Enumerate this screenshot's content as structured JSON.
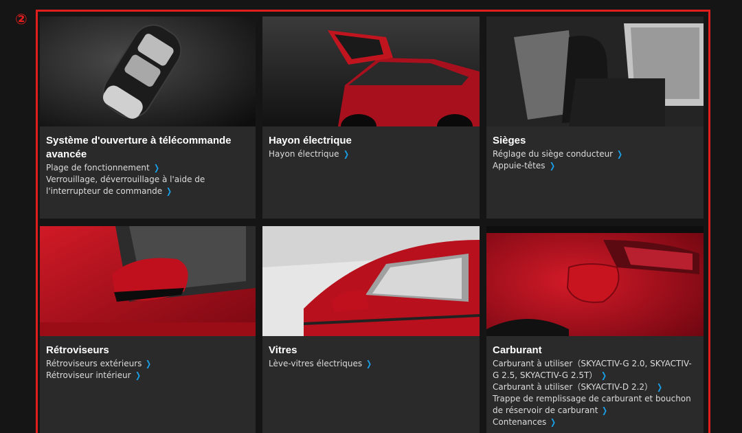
{
  "marker": {
    "text": "②",
    "color": "#e01e1e"
  },
  "accent": {
    "frame": "#e01e1e",
    "chevron": "#1aa0e8"
  },
  "cards": [
    {
      "title": "Système d'ouverture à télécommande avancée",
      "image": "smart-key-fob",
      "links": [
        {
          "label": "Plage de fonctionnement",
          "icon": "chevron-right-icon"
        },
        {
          "label": "Verrouillage, déverrouillage à l'aide de l'interrupteur de commande",
          "icon": "chevron-right-icon"
        }
      ]
    },
    {
      "title": "Hayon électrique",
      "image": "power-liftgate",
      "links": [
        {
          "label": "Hayon électrique",
          "icon": "chevron-right-icon"
        }
      ]
    },
    {
      "title": "Sièges",
      "image": "driver-seat",
      "links": [
        {
          "label": "Réglage du siège conducteur",
          "icon": "chevron-right-icon"
        },
        {
          "label": "Appuie-têtes",
          "icon": "chevron-right-icon"
        }
      ]
    },
    {
      "title": "Rétroviseurs",
      "image": "side-mirror",
      "links": [
        {
          "label": "Rétroviseurs extérieurs",
          "icon": "chevron-right-icon"
        },
        {
          "label": "Rétroviseur intérieur",
          "icon": "chevron-right-icon"
        }
      ]
    },
    {
      "title": "Vitres",
      "image": "side-window",
      "links": [
        {
          "label": "Lève-vitres électriques",
          "icon": "chevron-right-icon"
        }
      ]
    },
    {
      "title": "Carburant",
      "image": "fuel-door",
      "links": [
        {
          "label": "Carburant à utiliser（SKYACTIV-G 2.0, SKYACTIV-G 2.5, SKYACTIV-G 2.5T）",
          "icon": "chevron-right-icon"
        },
        {
          "label": "Carburant à utiliser（SKYACTIV-D 2.2）",
          "icon": "chevron-right-icon"
        },
        {
          "label": "Trappe de remplissage de carburant et bouchon de réservoir de carburant",
          "icon": "chevron-right-icon"
        },
        {
          "label": "Contenances",
          "icon": "chevron-right-icon"
        }
      ]
    }
  ]
}
